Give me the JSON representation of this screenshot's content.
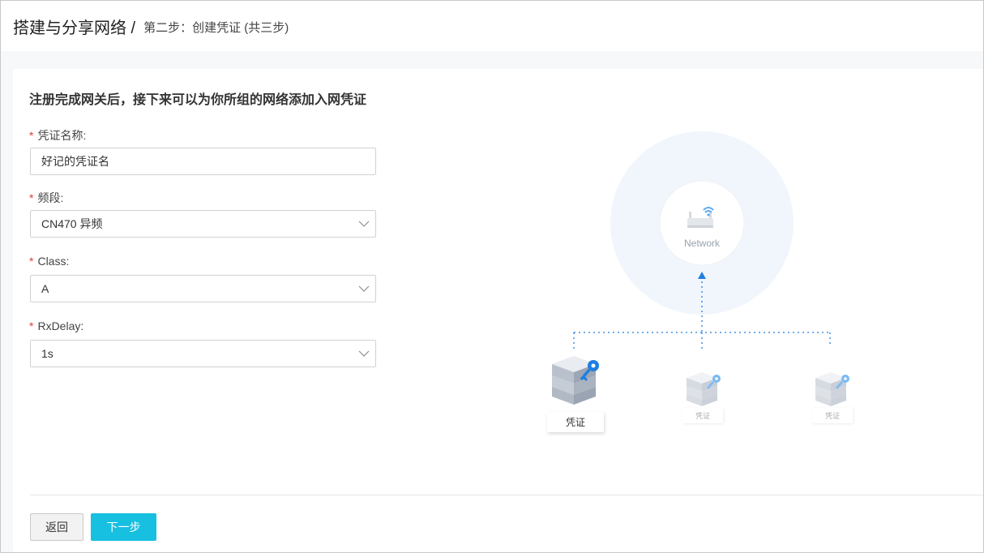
{
  "header": {
    "title": "搭建与分享网络 /",
    "step": "第二步：创建凭证 (共三步)"
  },
  "intro": "注册完成网关后，接下来可以为你所组的网络添加入网凭证",
  "form": {
    "required_mark": "*",
    "credential_name": {
      "label": "凭证名称:",
      "value": "好记的凭证名"
    },
    "band": {
      "label": "频段:",
      "value": "CN470 异频"
    },
    "class": {
      "label": "Class:",
      "value": "A"
    },
    "rxdelay": {
      "label": "RxDelay:",
      "value": "1s"
    }
  },
  "diagram": {
    "network_label": "Network",
    "credentials": [
      {
        "label": "凭证",
        "active": true
      },
      {
        "label": "凭证",
        "active": false
      },
      {
        "label": "凭证",
        "active": false
      }
    ],
    "colors": {
      "accent": "#1f7fe0",
      "halo": "#f1f6fc"
    }
  },
  "buttons": {
    "back": "返回",
    "next": "下一步"
  },
  "colors": {
    "primary_button": "#17bfe0",
    "required": "#e4393c"
  }
}
